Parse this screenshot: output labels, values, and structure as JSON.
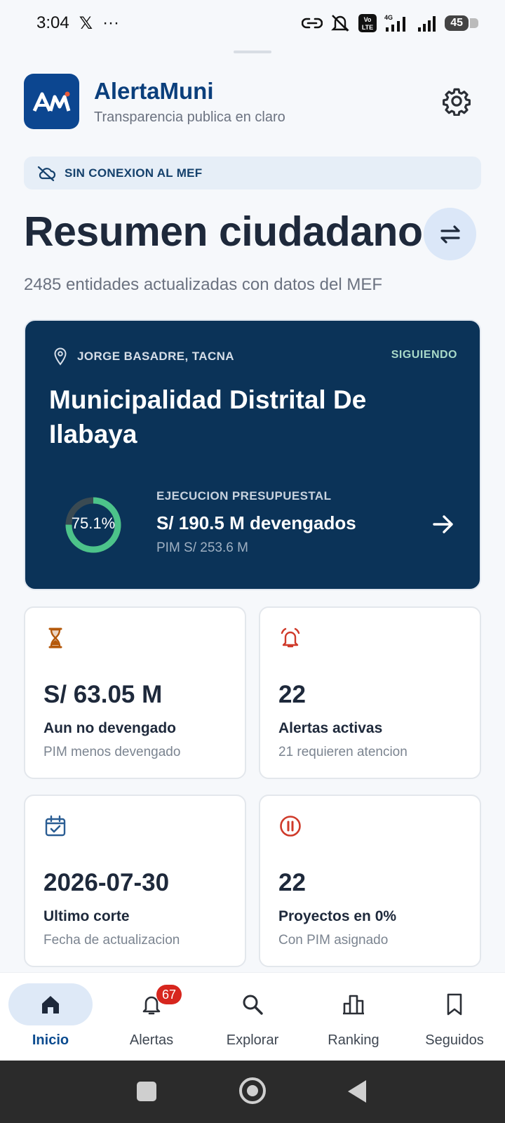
{
  "status_bar": {
    "time": "3:04",
    "x_label": "𝕏",
    "dots": "···",
    "battery": "45"
  },
  "app": {
    "title": "AlertaMuni",
    "subtitle": "Transparencia publica en claro"
  },
  "offline_banner": "SIN CONEXION AL MEF",
  "page": {
    "title": "Resumen ciudadano",
    "subtitle": "2485 entidades actualizadas con datos del MEF"
  },
  "hero": {
    "location": "JORGE BASADRE, TACNA",
    "follow_status": "SIGUIENDO",
    "municipality": "Municipalidad Distrital De Ilabaya",
    "execution_percent": "75.1%",
    "execution_fraction": 0.751,
    "execution_label": "EJECUCION PRESUPUESTAL",
    "execution_value": "S/ 190.5 M devengados",
    "pim": "PIM S/ 253.6 M"
  },
  "cards": [
    {
      "value": "S/ 63.05 M",
      "label": "Aun no devengado",
      "desc": "PIM menos devengado",
      "icon": "hourglass-icon",
      "color": "#b4580a"
    },
    {
      "value": "22",
      "label": "Alertas activas",
      "desc": "21 requieren atencion",
      "icon": "alarm-bell-icon",
      "color": "#cf3a2a"
    },
    {
      "value": "2026-07-30",
      "label": "Ultimo corte",
      "desc": "Fecha de actualizacion",
      "icon": "calendar-check-icon",
      "color": "#2a5d93"
    },
    {
      "value": "22",
      "label": "Proyectos en 0%",
      "desc": "Con PIM asignado",
      "icon": "pause-circle-icon",
      "color": "#cf3a2a"
    }
  ],
  "nav": [
    {
      "label": "Inicio",
      "icon": "home-icon",
      "active": true
    },
    {
      "label": "Alertas",
      "icon": "bell-icon",
      "badge": "67"
    },
    {
      "label": "Explorar",
      "icon": "search-icon"
    },
    {
      "label": "Ranking",
      "icon": "bar-chart-icon"
    },
    {
      "label": "Seguidos",
      "icon": "bookmark-icon"
    }
  ],
  "colors": {
    "brand": "#0c4690",
    "hero_bg": "#0b3358",
    "success": "#4cc38a",
    "danger": "#d7261e"
  }
}
